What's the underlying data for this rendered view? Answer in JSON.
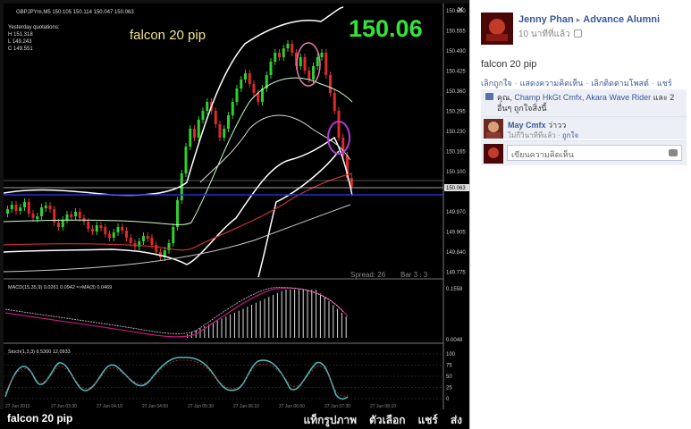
{
  "chart": {
    "symbol_title": "GBPJPYm,M5  150.105 150.114 150.047 150.063",
    "quotes_heading": "Yesterday quotations:",
    "quote_h": "H 151.318",
    "quote_l": "L 149.243",
    "quote_c": "C 149.551",
    "overlay_label": "falcon 20 pip",
    "big_price": "150.06",
    "spread": "Spread: 26",
    "bar_info": "Bar  3 : 3",
    "price_ticks": [
      "150.620",
      "150.555",
      "150.490",
      "150.425",
      "150.360",
      "150.295",
      "150.230",
      "150.165",
      "150.100",
      "150.063",
      "149.970",
      "149.905",
      "149.840",
      "149.775"
    ],
    "macd_label": "MACD(15,35,9) 0.0261 0.0942 =>MA(3) 0.0469",
    "macd_ticks": [
      "0.1558",
      "0.0048"
    ],
    "stoch_label": "Stoch(1,3,3) 6.5300 12.0933",
    "stoch_ticks": [
      "100",
      "75",
      "50",
      "25",
      "0"
    ],
    "time_ticks": [
      "27 Jun 2013",
      "27 Jun 03:30",
      "27 Jun 04:10",
      "27 Jun 04:50",
      "27 Jun 05:30",
      "27 Jun 06:10",
      "27 Jun 06:50",
      "27 Jun 07:30",
      "27 Jun 08:10"
    ],
    "bid_line_label": "150.063"
  },
  "bottom": {
    "caption": "falcon 20 pip",
    "tag_photo": "แท็กรูปภาพ",
    "options": "ตัวเลือก",
    "share": "แชร์",
    "send": "ส่ง",
    "close": "×"
  },
  "post": {
    "author": "Jenny Phan",
    "arrow": "▸",
    "group": "Advance Alumni",
    "time": "10 นาทีที่แล้ว",
    "text": "falcon 20 pip",
    "action_unlike": "เลิกถูกใจ",
    "action_comment": "แสดงความคิดเห็น",
    "action_unfollow": "เลิกติดตามโพสต์",
    "action_share": "แชร์",
    "likes_prefix": "คุณ,",
    "likes_names": "Champ HkGt Cmfx, Akara Wave Rider",
    "likes_suffix": "และ 2 อื่นๆ ถูกใจสิ่งนี้",
    "comment_name": "May Cmfx",
    "comment_text": "ว่าวว",
    "comment_time": "ไม่กี่วินาทีที่แล้ว",
    "comment_like": "ถูกใจ",
    "write_placeholder": "เขียนความคิดเห็น"
  }
}
